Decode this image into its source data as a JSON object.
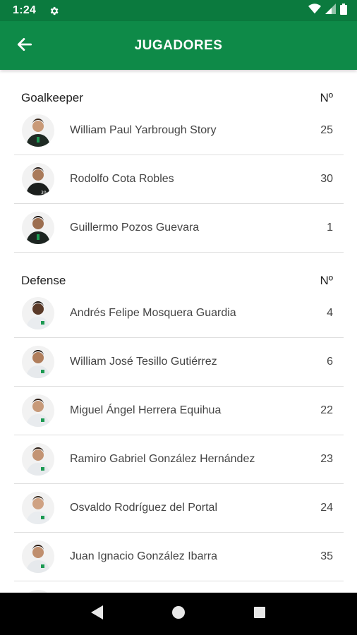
{
  "status_bar": {
    "time": "1:24",
    "icons": [
      "gear-icon",
      "wifi-icon",
      "signal-icon",
      "battery-icon"
    ]
  },
  "app_bar": {
    "title": "JUGADORES",
    "back_icon": "arrow-left-icon",
    "background_color": "#0e8a48"
  },
  "sections": [
    {
      "title": "Goalkeeper",
      "number_header": "Nº",
      "players": [
        {
          "name": "William Paul Yarbrough Story",
          "number": "25",
          "kit": "dark"
        },
        {
          "name": "Rodolfo Cota Robles",
          "number": "30",
          "kit": "dark"
        },
        {
          "name": "Guillermo Pozos Guevara",
          "number": "1",
          "kit": "dark"
        }
      ]
    },
    {
      "title": "Defense",
      "number_header": "Nº",
      "players": [
        {
          "name": "Andrés Felipe Mosquera Guardia",
          "number": "4",
          "kit": "light"
        },
        {
          "name": "William José Tesillo Gutiérrez",
          "number": "6",
          "kit": "light"
        },
        {
          "name": "Miguel Ángel Herrera Equihua",
          "number": "22",
          "kit": "light"
        },
        {
          "name": "Ramiro Gabriel González Hernández",
          "number": "23",
          "kit": "light"
        },
        {
          "name": "Osvaldo Rodríguez del Portal",
          "number": "24",
          "kit": "light"
        },
        {
          "name": "Juan Ignacio González Ibarra",
          "number": "35",
          "kit": "light"
        }
      ]
    }
  ],
  "nav_bar": {
    "buttons": [
      "back-triangle-icon",
      "home-circle-icon",
      "recents-square-icon"
    ]
  }
}
